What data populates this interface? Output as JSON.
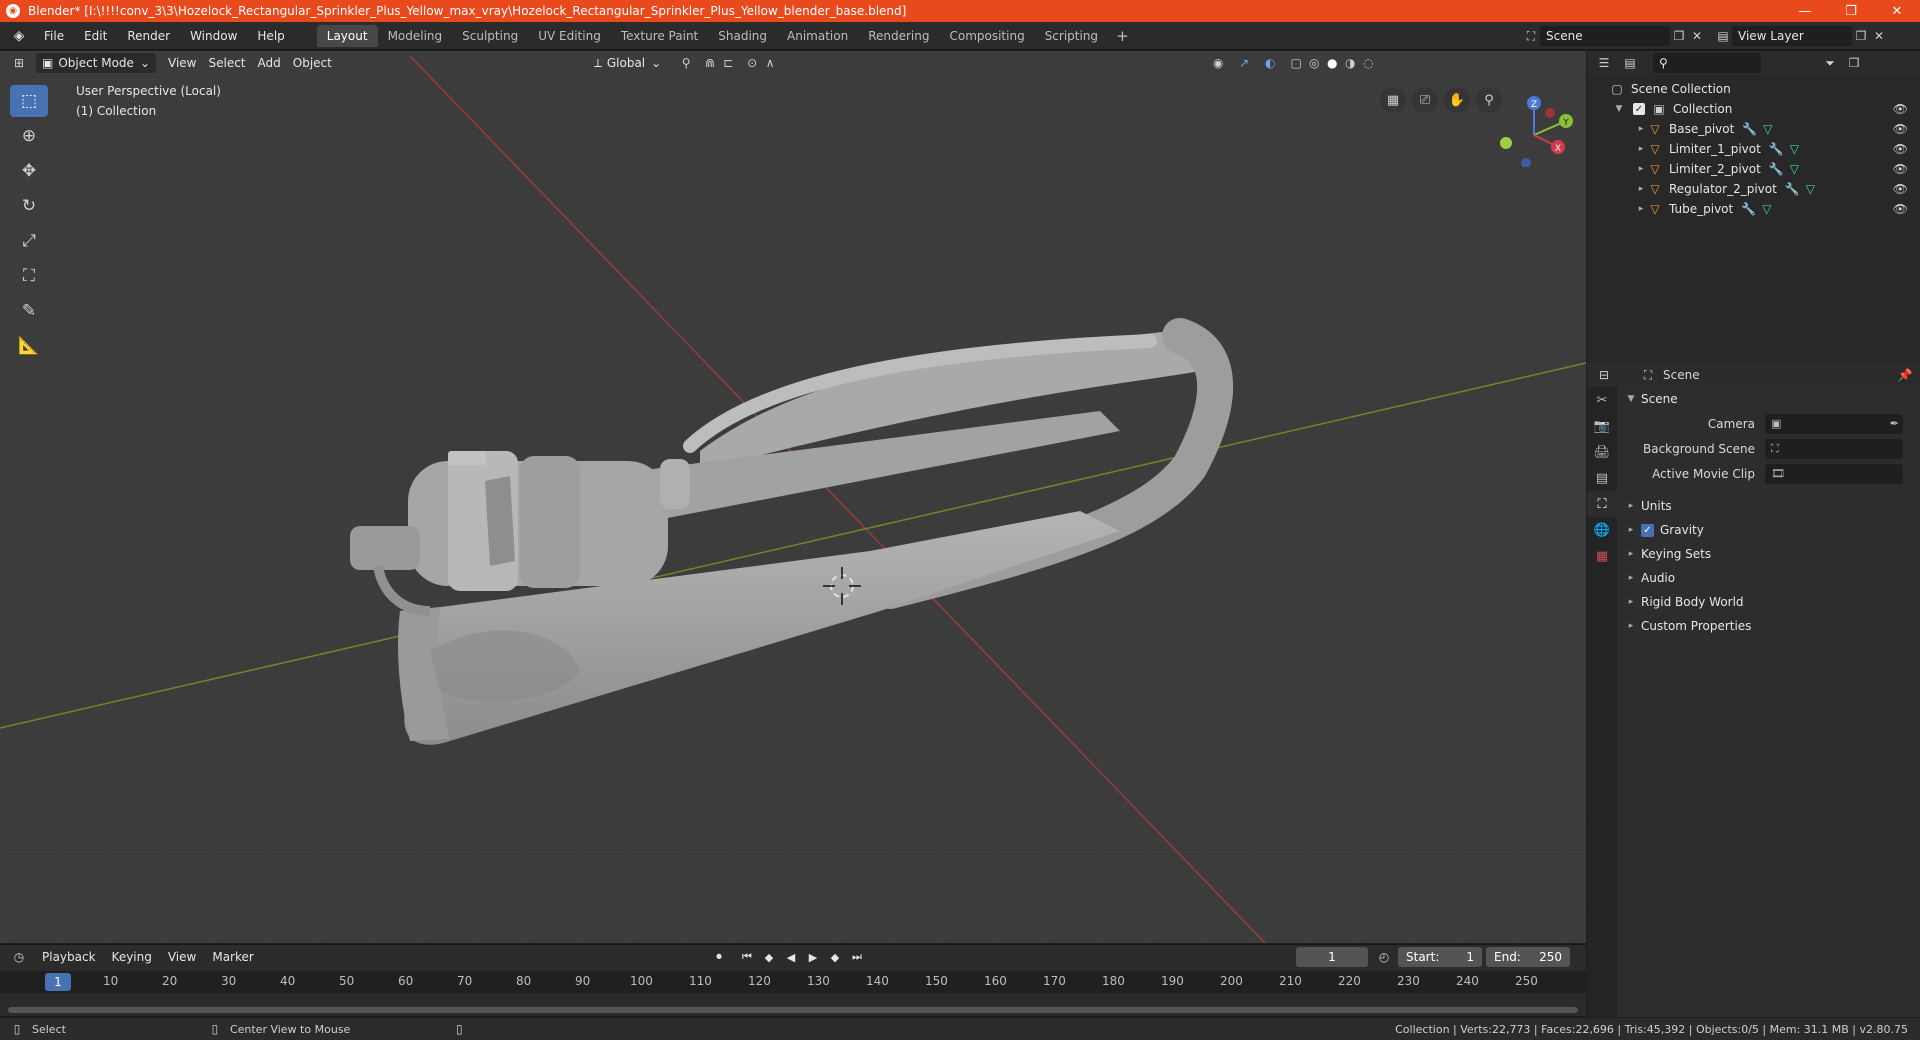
{
  "window": {
    "title": "Blender* [I:\\!!!!conv_3\\3\\Hozelock_Rectangular_Sprinkler_Plus_Yellow_max_vray\\Hozelock_Rectangular_Sprinkler_Plus_Yellow_blender_base.blend]",
    "minimize": "—",
    "maximize": "❐",
    "close": "✕"
  },
  "menu": [
    "File",
    "Edit",
    "Render",
    "Window",
    "Help"
  ],
  "workspaces": [
    "Layout",
    "Modeling",
    "Sculpting",
    "UV Editing",
    "Texture Paint",
    "Shading",
    "Animation",
    "Rendering",
    "Compositing",
    "Scripting"
  ],
  "workspaces_plus": "+",
  "scene_selector": "Scene",
  "view_layer": "View Layer",
  "viewport": {
    "mode": "Object Mode",
    "menus": [
      "View",
      "Select",
      "Add",
      "Object"
    ],
    "orientation": "Global",
    "info_line1": "User Perspective (Local)",
    "info_line2": "(1) Collection",
    "gizmo": {
      "x": "X",
      "y": "Y",
      "z": "Z"
    }
  },
  "outliner": {
    "search_placeholder": "",
    "root": "Scene Collection",
    "collection": "Collection",
    "items": [
      {
        "name": "Base_pivot"
      },
      {
        "name": "Limiter_1_pivot"
      },
      {
        "name": "Limiter_2_pivot"
      },
      {
        "name": "Regulator_2_pivot"
      },
      {
        "name": "Tube_pivot"
      }
    ]
  },
  "properties": {
    "header": "Scene",
    "section": "Scene",
    "fields": [
      {
        "label": "Camera",
        "value": ""
      },
      {
        "label": "Background Scene",
        "value": ""
      },
      {
        "label": "Active Movie Clip",
        "value": ""
      }
    ],
    "subsections": [
      "Units",
      "Gravity",
      "Keying Sets",
      "Audio",
      "Rigid Body World",
      "Custom Properties"
    ]
  },
  "timeline": {
    "menus": [
      "Playback",
      "Keying",
      "View",
      "Marker"
    ],
    "current_frame": "1",
    "start_label": "Start:",
    "start": "1",
    "end_label": "End:",
    "end": "250",
    "ticks": [
      "10",
      "20",
      "30",
      "40",
      "50",
      "60",
      "70",
      "80",
      "90",
      "100",
      "110",
      "120",
      "130",
      "140",
      "150",
      "160",
      "170",
      "180",
      "190",
      "200",
      "210",
      "220",
      "230",
      "240",
      "250"
    ]
  },
  "status": {
    "left1": "Select",
    "left2": "Center View to Mouse",
    "right": "Collection | Verts:22,773 | Faces:22,696 | Tris:45,392 | Objects:0/5 | Mem: 31.1 MB | v2.80.75"
  },
  "colors": {
    "titlebar": "#e8491d",
    "accent": "#4772b3",
    "viewport_bg": "#3c3c3c",
    "x_axis": "#c93a3a",
    "y_axis": "#7fa32b"
  }
}
